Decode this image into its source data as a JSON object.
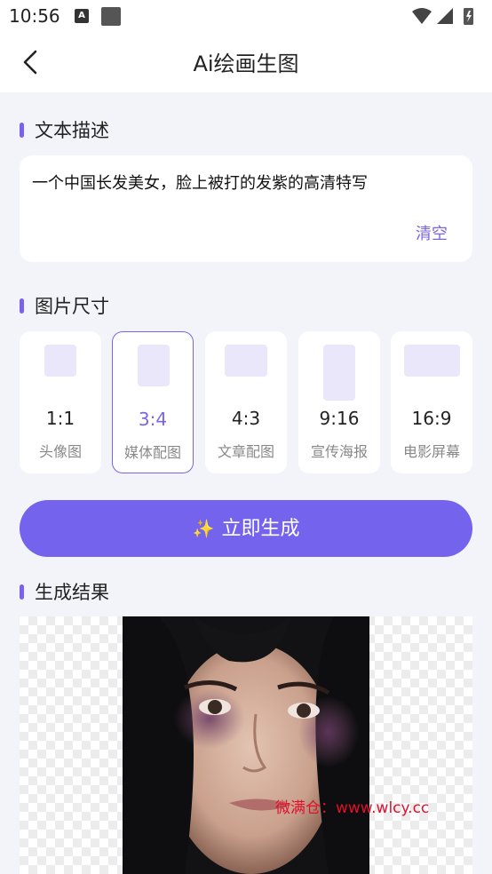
{
  "status_bar": {
    "time": "10:56",
    "notif_icon_letter": "A"
  },
  "header": {
    "title": "Ai绘画生图"
  },
  "description": {
    "section_title": "文本描述",
    "text": "一个中国长发美女，脸上被打的发紫的高清特写",
    "clear_label": "清空"
  },
  "image_size": {
    "section_title": "图片尺寸",
    "selected": "3:4",
    "options": [
      {
        "ratio": "1:1",
        "label": "头像图"
      },
      {
        "ratio": "3:4",
        "label": "媒体配图"
      },
      {
        "ratio": "4:3",
        "label": "文章配图"
      },
      {
        "ratio": "9:16",
        "label": "宣传海报"
      },
      {
        "ratio": "16:9",
        "label": "电影屏幕"
      }
    ]
  },
  "generate_button": {
    "label": "立即生成",
    "icon": "sparkle-icon"
  },
  "result": {
    "section_title": "生成结果"
  },
  "watermark": {
    "text": "微满仓：www.wlcy.cc"
  },
  "colors": {
    "accent": "#7463ec",
    "selected_text": "#7b65e6",
    "preview_fill": "#ebe7fb",
    "background": "#f3f4f9"
  }
}
